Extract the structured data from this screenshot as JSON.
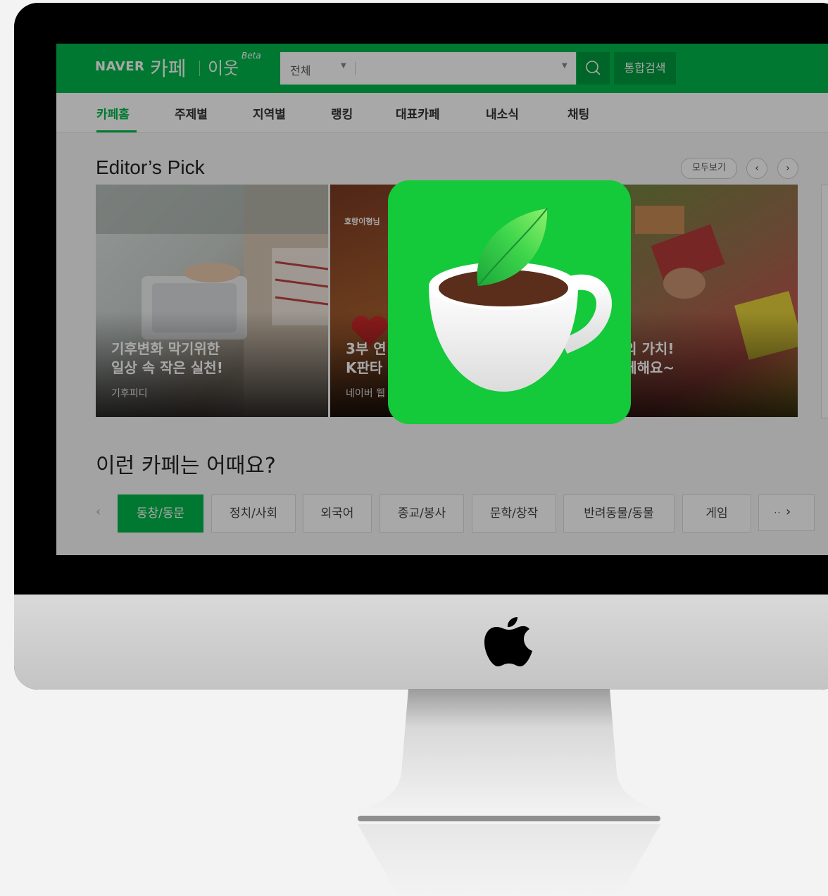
{
  "colors": {
    "accent": "#03b74b",
    "dark_accent": "#019a3e",
    "app_icon_bg": "#14c93a"
  },
  "header": {
    "naver": "NAVER",
    "cafe": "카페",
    "neighbor": "이웃",
    "beta": "Beta",
    "search": {
      "category": "전체",
      "value": "",
      "placeholder": ""
    },
    "search_icon": "search-icon",
    "total_search": "통합검색"
  },
  "nav": {
    "items": [
      "카페홈",
      "주제별",
      "지역별",
      "랭킹",
      "대표카페",
      "내소식",
      "채팅"
    ],
    "active": "카페홈"
  },
  "editors_pick": {
    "title": "Editor’s Pick",
    "view_all": "모두보기",
    "prev": "‹",
    "next": "›",
    "cards": [
      {
        "title": "기후변화 막기위한\n일상 속 작은 실천!",
        "sub": "기후피디"
      },
      {
        "title": "3부 연\nK판타",
        "sub": "네이버 웹",
        "tag": "호랑이형님"
      },
      {
        "title": "는 독서의 가치!\n들과 함께해요~",
        "sub": ""
      }
    ]
  },
  "recommend": {
    "title": "이런 카페는 어때요?",
    "prev": "‹",
    "next": "›",
    "chips": [
      "동창/동문",
      "정치/사회",
      "외국어",
      "종교/봉사",
      "문학/창작",
      "반려동물/동물",
      "게임",
      "ᆢ"
    ],
    "active": "동창/동문"
  },
  "overlay": {
    "icon": "naver-cafe-app-icon"
  },
  "device": {
    "logo": "apple-logo-icon"
  }
}
